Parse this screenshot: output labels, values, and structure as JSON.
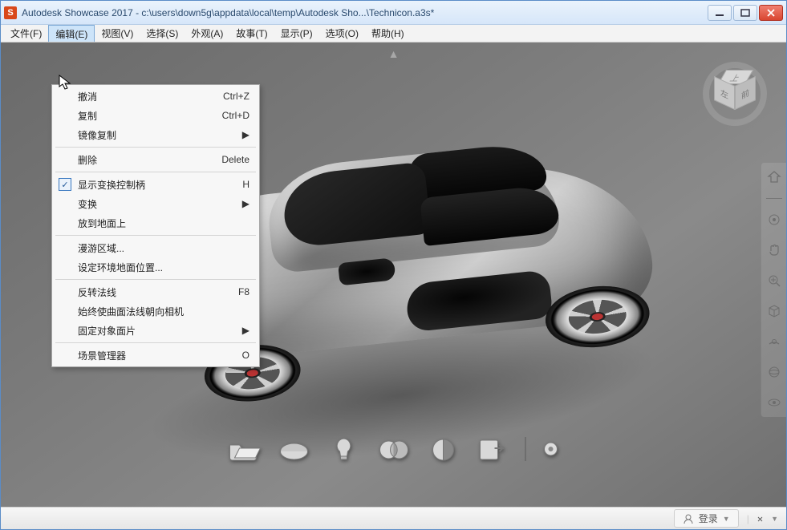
{
  "window": {
    "app_icon_letter": "S",
    "title": "Autodesk Showcase 2017 - c:\\users\\down5g\\appdata\\local\\temp\\Autodesk Sho...\\Technicon.a3s*"
  },
  "menubar": {
    "items": [
      {
        "label": "文件(F)"
      },
      {
        "label": "编辑(E)"
      },
      {
        "label": "视图(V)"
      },
      {
        "label": "选择(S)"
      },
      {
        "label": "外观(A)"
      },
      {
        "label": "故事(T)"
      },
      {
        "label": "显示(P)"
      },
      {
        "label": "选项(O)"
      },
      {
        "label": "帮助(H)"
      }
    ],
    "active_index": 1
  },
  "dropdown": {
    "groups": [
      [
        {
          "label": "撤消",
          "shortcut": "Ctrl+Z"
        },
        {
          "label": "复制",
          "shortcut": "Ctrl+D"
        },
        {
          "label": "镜像复制",
          "submenu": true
        }
      ],
      [
        {
          "label": "删除",
          "shortcut": "Delete"
        }
      ],
      [
        {
          "label": "显示变换控制柄",
          "shortcut": "H",
          "checked": true
        },
        {
          "label": "变换",
          "submenu": true
        },
        {
          "label": "放到地面上"
        }
      ],
      [
        {
          "label": "漫游区域..."
        },
        {
          "label": "设定环境地面位置..."
        }
      ],
      [
        {
          "label": "反转法线",
          "shortcut": "F8"
        },
        {
          "label": "始终使曲面法线朝向相机"
        },
        {
          "label": "固定对象面片",
          "submenu": true
        }
      ],
      [
        {
          "label": "场景管理器",
          "shortcut": "O"
        }
      ]
    ]
  },
  "viewcube": {
    "top": "上",
    "left": "左",
    "right": "前"
  },
  "navbar_icons": [
    "home-icon",
    "target-icon",
    "hand-icon",
    "zoom-plus-icon",
    "cube-icon",
    "orbit-arc-icon",
    "orbit-full-icon",
    "eye-icon"
  ],
  "bottom_tools": [
    "open-icon",
    "env-icon",
    "light-icon",
    "material-icon",
    "compare-icon",
    "export-icon"
  ],
  "status": {
    "login": "登录",
    "x_glyph": "✕"
  }
}
